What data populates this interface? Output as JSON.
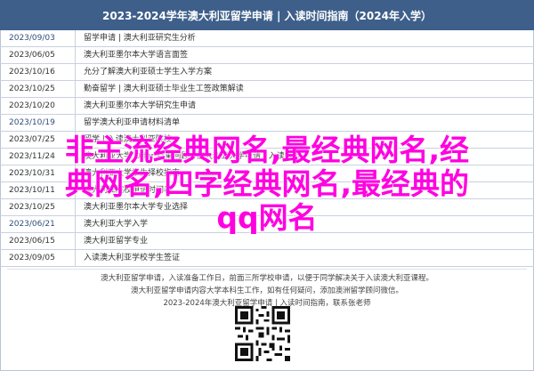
{
  "header": {
    "title": "2023-2024学年澳大利亚留学申请 | 入读时间指南（2024年入学）"
  },
  "rows": [
    {
      "date": "2023/09/03",
      "title": "留学申请 | 澳大利亚研究生分析"
    },
    {
      "date": "2023/06/05",
      "title": "澳大利亚墨尔本大学语言面签"
    },
    {
      "date": "2023/10/16",
      "title": "允分了解澳大利亚硕士学生入学方案"
    },
    {
      "date": "2023/10/25",
      "title": "勤奋留学 | 澳大利亚硕士毕业生工签政策解读"
    },
    {
      "date": "2023/10/20",
      "title": "澳大利亚墨尔本大学研究生申请"
    },
    {
      "date": "2023/10/19",
      "title": "留学澳大利亚申请材料清单"
    },
    {
      "date": "2023/07/25",
      "title": "留学 | 入读澳大利亚院校"
    },
    {
      "date": "2023/11/24",
      "title": "澳大利亚大学 Offer 结果回顾 | 澳大利亚大学申请 | 入读解析"
    },
    {
      "date": "2023/10/31",
      "title": "澳大利亚大学学生择校指南"
    },
    {
      "date": "2023/10/11",
      "title": "澳大利亚院校申请时间表"
    },
    {
      "date": "2023/10/25",
      "title": "澳大利亚墨尔本大学专业选择"
    },
    {
      "date": "2023/06/21",
      "title": "澳大利亚大学入学"
    },
    {
      "date": "2023/06/15",
      "title": "澳大利亚留学专业"
    },
    {
      "date": "2023/09/05",
      "title": "入读澳大利亚学校学生签证"
    }
  ],
  "overlay": {
    "line1": "非主流经典网名,最经典网名,经",
    "line2": "典网名,四字经典网名,最经典的",
    "line3": "qq网名"
  },
  "footer": {
    "line1": "澳大利亚留学申请，入读准备工作日，前面三所学校申请，以便于同学解决关于入读澳大利亚课程。",
    "line2": "澳大利亚留学申请内容大学本科生工作，如有任何疑问，添加澳洲留学顾问微信。",
    "line3": "2023-2024年澳大利亚留学申请 | 入读时间指南，联系张老师"
  }
}
